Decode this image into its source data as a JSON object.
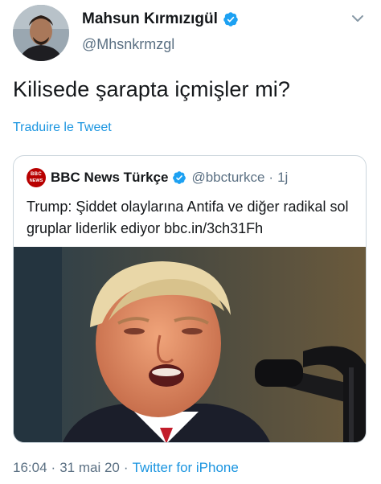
{
  "author": {
    "name": "Mahsun Kırmızıgül",
    "handle": "@Mhsnkrmzgl",
    "avatar_icon": "profile-avatar",
    "verified_icon": "verified-badge-icon"
  },
  "tweet": {
    "text": "Kilisede şarapta içmişler mi?",
    "translate_label": "Traduire le Tweet"
  },
  "quoted": {
    "logo_text_1": "BBC",
    "logo_text_2": "NEWS",
    "name": "BBC News Türkçe",
    "handle": "@bbcturkce",
    "separator": "·",
    "time": "1j",
    "text": "Trump: Şiddet olaylarına Antifa ve diğer radikal sol gruplar liderlik ediyor bbc.in/3ch31Fh",
    "media_icon": "news-photo"
  },
  "footer": {
    "time": "16:04",
    "separator": "·",
    "date": "31 mai 20",
    "source": "Twitter for iPhone"
  },
  "colors": {
    "accent": "#1b95e0",
    "verified": "#1da1f2",
    "secondary_text": "#5b7083",
    "bbc_red": "#b80000"
  }
}
